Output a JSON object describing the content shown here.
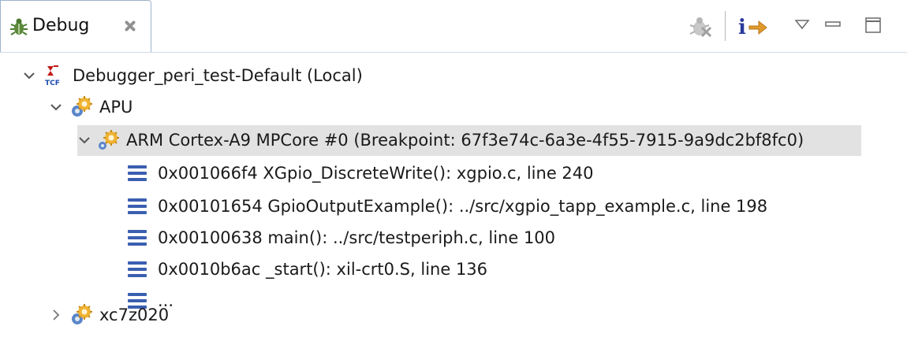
{
  "tab": {
    "label": "Debug",
    "icon": "bug-icon",
    "close_icon": "close-icon"
  },
  "toolbar": {
    "disconnect_icon": "remove-terminated-icon",
    "step_icon": "instruction-stepping-icon",
    "menu_icon": "view-menu-icon",
    "minimize_icon": "minimize-icon",
    "maximize_icon": "maximize-icon"
  },
  "tree": {
    "launch": {
      "label": "Debugger_peri_test-Default (Local)",
      "icon": "tcf-launch-icon",
      "expanded": true
    },
    "apu": {
      "label": "APU",
      "icon": "processor-group-icon",
      "expanded": true
    },
    "core": {
      "label": "ARM Cortex-A9 MPCore #0 (Breakpoint: 67f3e74c-6a3e-4f55-7915-9a9dc2bf8fc0)",
      "icon": "core-suspended-icon",
      "expanded": true,
      "selected": true
    },
    "frames": [
      {
        "label": "0x001066f4 XGpio_DiscreteWrite(): xgpio.c, line 240"
      },
      {
        "label": "0x00101654 GpioOutputExample(): ../src/xgpio_tapp_example.c, line 198"
      },
      {
        "label": "0x00100638 main(): ../src/testperiph.c, line 100"
      },
      {
        "label": "0x0010b6ac _start(): xil-crt0.S, line 136"
      },
      {
        "label": "..."
      }
    ],
    "target": {
      "label": "xc7z020",
      "icon": "processor-group-icon",
      "expanded": false
    }
  },
  "colors": {
    "selection": "#e2e2e2",
    "frame_icon": "#3a5fb0",
    "tab_border": "#9fb3cc"
  }
}
